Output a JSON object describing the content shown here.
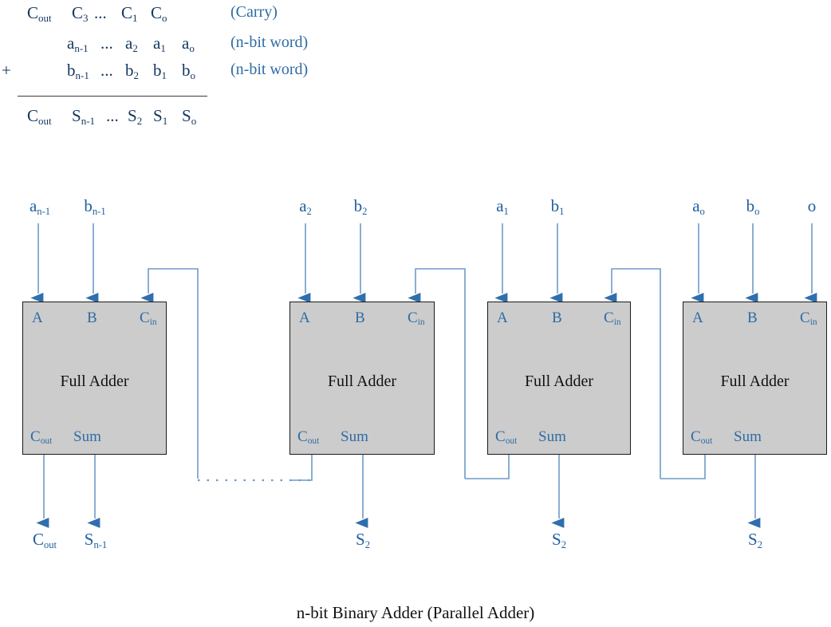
{
  "figure": {
    "caption": "n-bit Binary Adder (Parallel Adder)"
  },
  "expression": {
    "rows": [
      {
        "id": "carry-row",
        "prefix": "",
        "terms": [
          "C",
          "C",
          "...",
          "C",
          "C"
        ],
        "subs": [
          "out",
          "3",
          "",
          "1",
          "o"
        ],
        "note": "(Carry)"
      },
      {
        "id": "operand-a-row",
        "prefix": "",
        "terms": [
          "a",
          "...",
          "a",
          "a",
          "a"
        ],
        "subs": [
          "n-1",
          "",
          "2",
          "1",
          "o"
        ],
        "note": "(n-bit word)"
      },
      {
        "id": "operand-b-row",
        "prefix": "+",
        "terms": [
          "b",
          "...",
          "b",
          "b",
          "b"
        ],
        "subs": [
          "n-1",
          "",
          "2",
          "1",
          "o"
        ],
        "note": "(n-bit word)"
      },
      {
        "id": "sum-row",
        "prefix": "",
        "terms": [
          "C",
          "S",
          "...",
          "S",
          "S",
          "S"
        ],
        "subs": [
          "out",
          "n-1",
          "",
          "2",
          "1",
          "o"
        ],
        "note": ""
      }
    ]
  },
  "adders": [
    {
      "id": "adder-msb",
      "title": "Full Adder",
      "ports": {
        "a": "A",
        "b": "B",
        "cin": "C",
        "cin_sub": "in",
        "cout": "C",
        "cout_sub": "out",
        "sum": "Sum"
      },
      "inputs": {
        "a_label": "a",
        "a_sub": "n-1",
        "b_label": "b",
        "b_sub": "n-1",
        "cin_label": "",
        "cin_sub_label": ""
      },
      "outputs": {
        "cout_label": "C",
        "cout_sub": "out",
        "sum_label": "S",
        "sum_sub": "n-1"
      }
    },
    {
      "id": "adder-2",
      "title": "Full Adder",
      "ports": {
        "a": "A",
        "b": "B",
        "cin": "C",
        "cin_sub": "in",
        "cout": "C",
        "cout_sub": "out",
        "sum": "Sum"
      },
      "inputs": {
        "a_label": "a",
        "a_sub": "2",
        "b_label": "b",
        "b_sub": "2",
        "cin_label": "",
        "cin_sub_label": ""
      },
      "outputs": {
        "cout_label": "",
        "cout_sub": "",
        "sum_label": "S",
        "sum_sub": "2"
      }
    },
    {
      "id": "adder-1",
      "title": "Full Adder",
      "ports": {
        "a": "A",
        "b": "B",
        "cin": "C",
        "cin_sub": "in",
        "cout": "C",
        "cout_sub": "out",
        "sum": "Sum"
      },
      "inputs": {
        "a_label": "a",
        "a_sub": "1",
        "b_label": "b",
        "b_sub": "1",
        "cin_label": "",
        "cin_sub_label": ""
      },
      "outputs": {
        "cout_label": "",
        "cout_sub": "",
        "sum_label": "S",
        "sum_sub": "2"
      }
    },
    {
      "id": "adder-lsb",
      "title": "Full Adder",
      "ports": {
        "a": "A",
        "b": "B",
        "cin": "C",
        "cin_sub": "in",
        "cout": "C",
        "cout_sub": "out",
        "sum": "Sum"
      },
      "inputs": {
        "a_label": "a",
        "a_sub": "o",
        "b_label": "b",
        "b_sub": "o",
        "cin_label": "o",
        "cin_sub_label": ""
      },
      "outputs": {
        "cout_label": "",
        "cout_sub": "",
        "sum_label": "S",
        "sum_sub": "2"
      }
    }
  ],
  "colors": {
    "wire": "#6d9bc9",
    "arrow_fill": "#2f6fad",
    "box_fill": "#cccccc",
    "box_stroke": "#1a1a1a",
    "label_blue": "#1f5fa0",
    "note_blue": "#2e6ca4",
    "text_black": "#111111"
  }
}
